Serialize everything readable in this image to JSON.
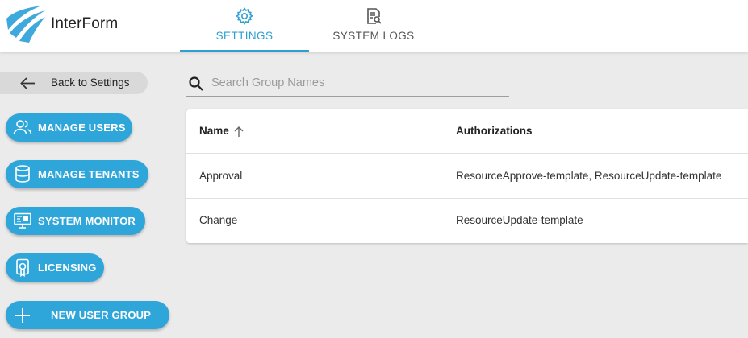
{
  "app": {
    "title": "InterForm"
  },
  "tabs": [
    {
      "label": "SETTINGS",
      "icon": "gear-icon",
      "active": true
    },
    {
      "label": "SYSTEM LOGS",
      "icon": "log-search-icon",
      "active": false
    }
  ],
  "sidebar": {
    "back_label": "Back to Settings",
    "items": [
      {
        "label": "MANAGE USERS",
        "icon": "users-icon"
      },
      {
        "label": "MANAGE TENANTS",
        "icon": "database-icon"
      },
      {
        "label": "SYSTEM MONITOR",
        "icon": "monitor-icon"
      },
      {
        "label": "LICENSING",
        "icon": "license-badge-icon"
      },
      {
        "label": "NEW USER GROUP",
        "icon": "plus-icon"
      }
    ]
  },
  "search": {
    "placeholder": "Search Group Names",
    "value": ""
  },
  "table": {
    "columns": [
      "Name",
      "Authorizations"
    ],
    "sort": {
      "column": "Name",
      "direction": "ascending"
    },
    "rows": [
      {
        "name": "Approval",
        "authorizations": "ResourceApprove-template, ResourceUpdate-template"
      },
      {
        "name": "Change",
        "authorizations": "ResourceUpdate-template"
      }
    ]
  },
  "colors": {
    "accent": "#2fa6da",
    "tab_active": "#2f9fd3",
    "background": "#ebebeb"
  }
}
